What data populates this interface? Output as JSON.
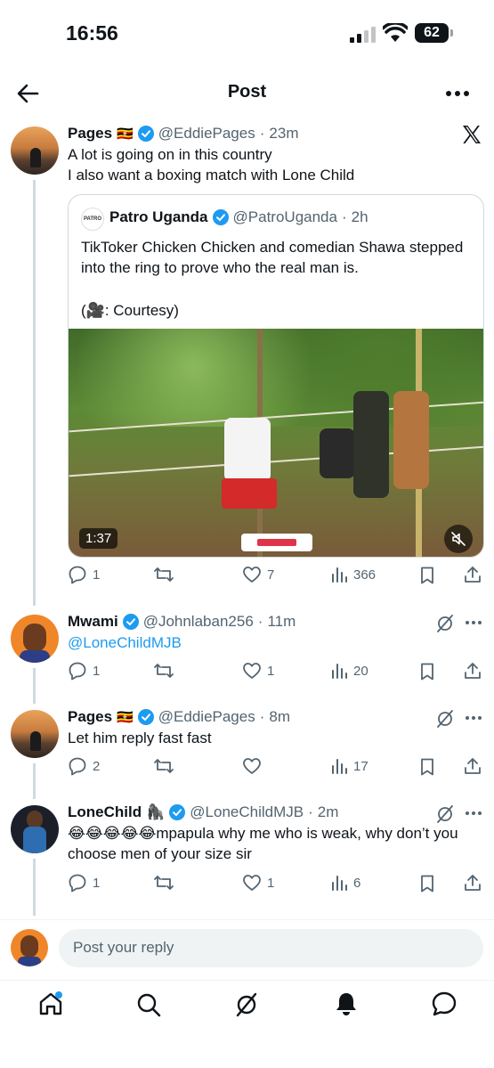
{
  "status_bar": {
    "time": "16:56",
    "battery": "62"
  },
  "header": {
    "title": "Post"
  },
  "main_post": {
    "name": "Pages",
    "flag": "🇺🇬",
    "handle": "@EddiePages",
    "dot": "·",
    "time": "23m",
    "line1": "A lot is going on in this country",
    "line2": "I also want a boxing match with Lone Child"
  },
  "quote": {
    "name": "Patro Uganda",
    "logo_text": "PATRO",
    "handle": "@PatroUganda",
    "dot": "·",
    "time": "2h",
    "text": "TikToker Chicken Chicken and comedian Shawa stepped into the ring to prove who the real man is.",
    "credit": "(🎥: Courtesy)",
    "video_duration": "1:37"
  },
  "main_actions": {
    "replies": "1",
    "reposts": "",
    "likes": "7",
    "views": "366"
  },
  "replies": [
    {
      "name": "Mwami",
      "handle": "@Johnlaban256",
      "dot": "·",
      "time": "11m",
      "text": "@LoneChildMJB",
      "replies": "1",
      "likes": "1",
      "views": "20"
    },
    {
      "name": "Pages",
      "flag": "🇺🇬",
      "handle": "@EddiePages",
      "dot": "·",
      "time": "8m",
      "text": "Let him reply fast fast",
      "replies": "2",
      "likes": "",
      "views": "17"
    },
    {
      "name": "LoneChild",
      "flag": "🦍",
      "handle": "@LoneChildMJB",
      "dot": "·",
      "time": "2m",
      "text": "😂😂😂😂😂mpapula why me who is weak, why don’t you choose men of your size sir",
      "replies": "1",
      "likes": "1",
      "views": "6"
    }
  ],
  "composer": {
    "placeholder": "Post your reply"
  },
  "colors": {
    "accent": "#1d9bf0",
    "text": "#0f1419",
    "muted": "#536471",
    "border": "#cfd9de"
  }
}
